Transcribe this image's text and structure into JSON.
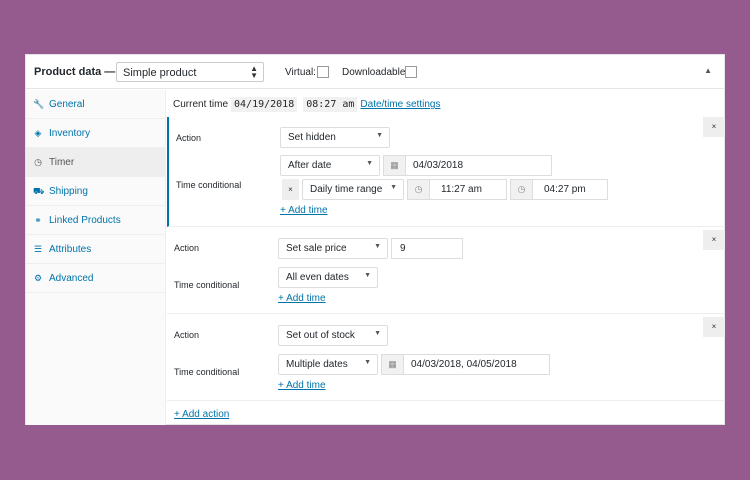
{
  "header": {
    "title": "Product data —",
    "product_type": "Simple product",
    "virtual_label": "Virtual:",
    "downloadable_label": "Downloadable:",
    "collapse_glyph": "▲"
  },
  "sidebar": {
    "items": [
      {
        "label": "General",
        "icon": "wrench-icon",
        "glyph": "🔧"
      },
      {
        "label": "Inventory",
        "icon": "tag-icon",
        "glyph": "◈"
      },
      {
        "label": "Timer",
        "icon": "clock-icon",
        "glyph": "◷"
      },
      {
        "label": "Shipping",
        "icon": "truck-icon",
        "glyph": "⛟"
      },
      {
        "label": "Linked Products",
        "icon": "link-icon",
        "glyph": "⚭"
      },
      {
        "label": "Attributes",
        "icon": "list-icon",
        "glyph": "☰"
      },
      {
        "label": "Advanced",
        "icon": "gear-icon",
        "glyph": "⚙"
      }
    ],
    "active": "Timer"
  },
  "current_time": {
    "label": "Current time",
    "date": "04/19/2018",
    "time": "08:27 am",
    "settings_link": "Date/time settings"
  },
  "rules": [
    {
      "action_label": "Action",
      "action_value": "Set hidden",
      "conditional_label": "Time conditional",
      "condition_type": "After date",
      "condition_date": "04/03/2018",
      "range_type": "Daily time range",
      "range_start": "11:27 am",
      "range_end": "04:27 pm",
      "add_time": "+ Add time",
      "remove": "×"
    },
    {
      "action_label": "Action",
      "action_value": "Set sale price",
      "price_value": "9",
      "conditional_label": "Time conditional",
      "condition_type": "All even dates",
      "add_time": "+ Add time",
      "remove": "×"
    },
    {
      "action_label": "Action",
      "action_value": "Set out of stock",
      "conditional_label": "Time conditional",
      "condition_type": "Multiple dates",
      "condition_dates": "04/03/2018, 04/05/2018",
      "add_time": "+ Add time",
      "remove": "×"
    }
  ],
  "add_action": "+ Add action",
  "glyphs": {
    "caret": "▼",
    "calendar": "▦",
    "clock": "◷",
    "remove_small": "×",
    "select_arrows": "▲▼"
  },
  "colors": {
    "background": "#955b8f",
    "link": "#0073aa",
    "active_border": "#0073aa"
  }
}
